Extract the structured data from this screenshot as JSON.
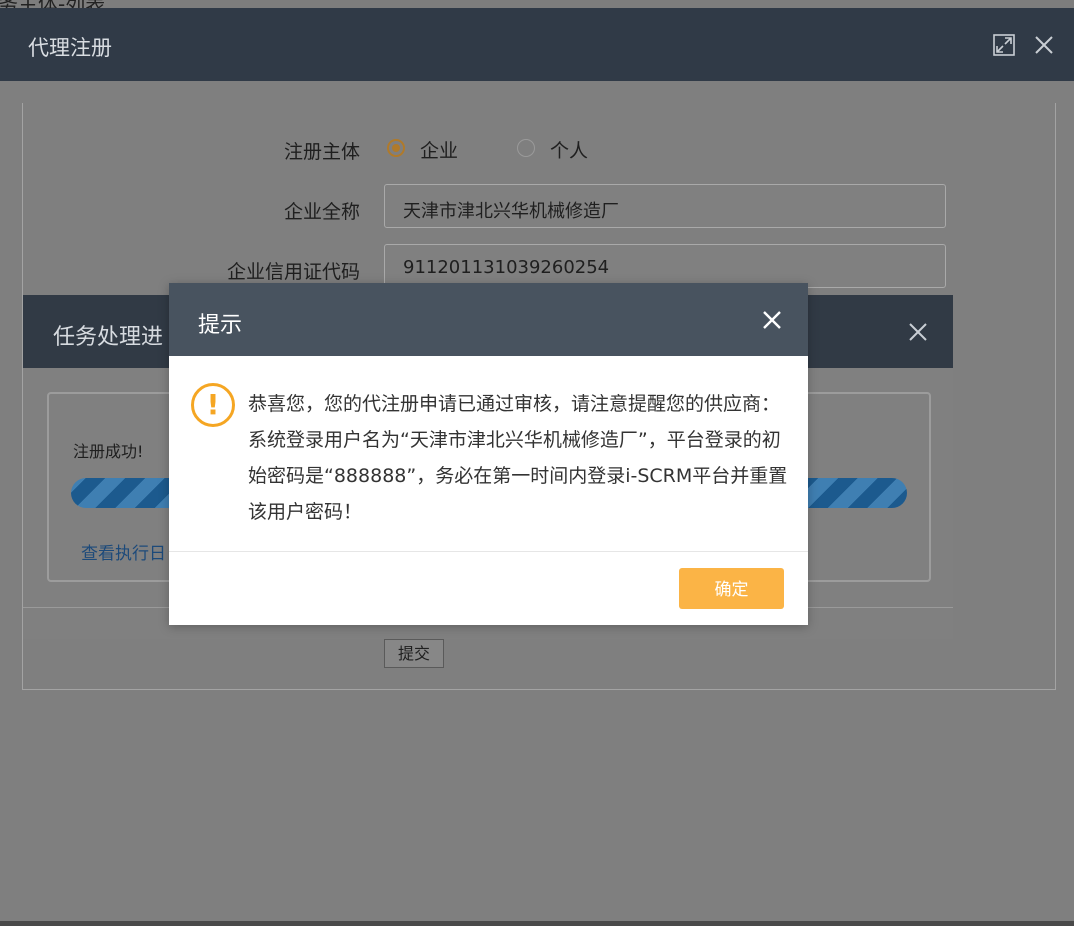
{
  "background_window": {
    "title_fragment": "务主体-列表"
  },
  "main_dialog": {
    "title": "代理注册",
    "maximize_icon": "maximize-icon",
    "close_icon": "close-icon"
  },
  "form": {
    "reg_subject_label": "注册主体",
    "radio_enterprise": "企业",
    "radio_individual": "个人",
    "selected": "企业",
    "company_name_label": "企业全称",
    "company_name_value": "天津市津北兴华机械修造厂",
    "credit_code_label": "企业信用证代码",
    "credit_code_value": "911201131039260254",
    "submit_label": "提交"
  },
  "progress_dialog": {
    "title": "任务处理进",
    "status_text": "注册成功!",
    "log_link": "查看执行日",
    "progress": 1.0
  },
  "alert_dialog": {
    "title": "提示",
    "message": "恭喜您，您的代注册申请已通过审核，请注意提醒您的供应商：系统登录用户名为“天津市津北兴华机械修造厂”，平台登录的初始密码是“888888”，务必在第一时间内登录i-SCRM平台并重置该用户密码！",
    "confirm_label": "确定",
    "icon": "warning-icon"
  },
  "colors": {
    "header_dark": "#303a47",
    "alert_header": "#48535f",
    "accent_orange": "#fbb446",
    "warning_orange": "#f5a623",
    "progress_blue": "#1c5a8e"
  }
}
